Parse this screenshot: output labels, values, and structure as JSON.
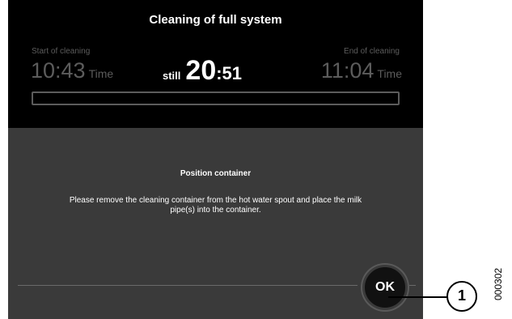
{
  "header": {
    "title": "Cleaning of full system"
  },
  "start": {
    "label": "Start of cleaning",
    "time": "10:43",
    "unit": "Time"
  },
  "end": {
    "label": "End of cleaning",
    "time": "11:04",
    "unit": "Time"
  },
  "remaining": {
    "prefix": "still",
    "minutes": "20",
    "seconds": ":51"
  },
  "progress": {
    "fraction": 0
  },
  "dialog": {
    "heading": "Position container",
    "message": "Please remove the cleaning container from the hot water spout and place the milk pipe(s) into the container.",
    "ok_label": "OK"
  },
  "annotation": {
    "callout": "1",
    "figure_id": "000302"
  },
  "colors": {
    "screen_bg": "#3a3a3a",
    "top_panel": "#000000",
    "dim_text": "#5c5c5c",
    "text": "#ffffff"
  }
}
